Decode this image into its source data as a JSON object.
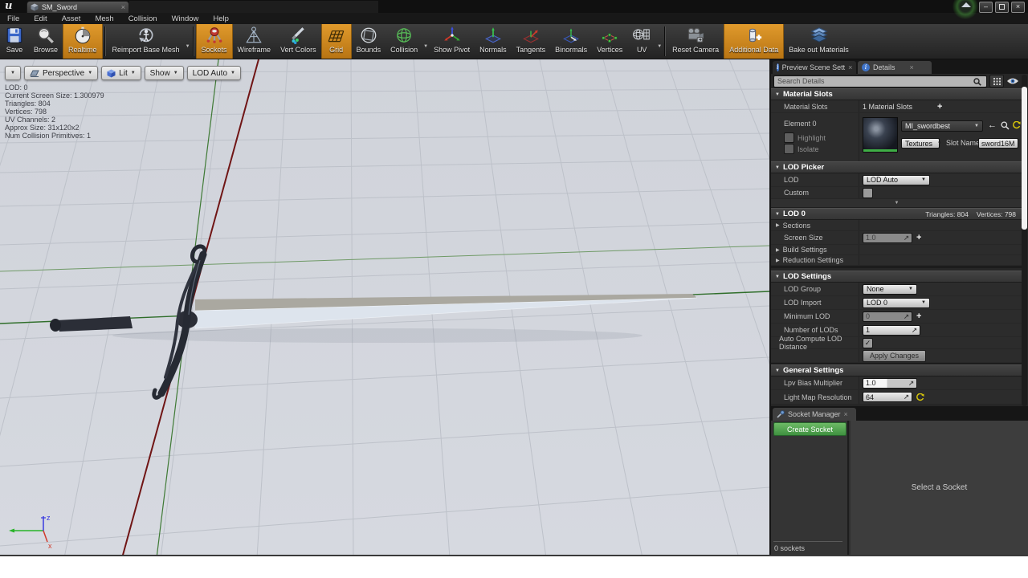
{
  "window": {
    "tab_title": "SM_Sword",
    "menu_items": [
      "File",
      "Edit",
      "Asset",
      "Mesh",
      "Collision",
      "Window",
      "Help"
    ],
    "minimize": "–",
    "close": "×"
  },
  "toolbar": {
    "items": [
      {
        "label": "Save"
      },
      {
        "label": "Browse"
      },
      {
        "label": "Realtime",
        "active": true
      },
      {
        "label": "Reimport Base Mesh",
        "dropdown": true
      },
      {
        "label": "Sockets",
        "active": true
      },
      {
        "label": "Wireframe"
      },
      {
        "label": "Vert Colors"
      },
      {
        "label": "Grid",
        "active": true
      },
      {
        "label": "Bounds"
      },
      {
        "label": "Collision",
        "dropdown": true
      },
      {
        "label": "Show Pivot"
      },
      {
        "label": "Normals"
      },
      {
        "label": "Tangents"
      },
      {
        "label": "Binormals"
      },
      {
        "label": "Vertices"
      },
      {
        "label": "UV",
        "dropdown": true
      },
      {
        "label": "Reset Camera"
      },
      {
        "label": "Additional Data",
        "active": true
      },
      {
        "label": "Bake out Materials"
      }
    ]
  },
  "viewport": {
    "buttons": {
      "perspective": "Perspective",
      "lit": "Lit",
      "show": "Show",
      "lod": "LOD Auto"
    },
    "stats": [
      "LOD:  0",
      "Current Screen Size:  1.300979",
      "Triangles:  804",
      "Vertices:  798",
      "UV Channels:  2",
      "Approx Size:  31x120x2",
      "Num Collision Primitives:  1"
    ],
    "gizmo": {
      "z_label": "z",
      "x_label": "x"
    }
  },
  "details": {
    "tab_preview": "Preview Scene Sett",
    "tab_details": "Details",
    "search_placeholder": "Search Details",
    "material_slots": {
      "header": "Material Slots",
      "slots_label": "Material Slots",
      "slots_value": "1 Material Slots",
      "element_label": "Element 0",
      "highlight_label": "Highlight",
      "isolate_label": "Isolate",
      "material_name": "MI_swordbest",
      "textures_label": "Textures",
      "slot_name_label": "Slot Name",
      "slot_name_value": "sword16M"
    },
    "lod_picker": {
      "header": "LOD Picker",
      "lod_label": "LOD",
      "lod_value": "LOD Auto",
      "custom_label": "Custom"
    },
    "lod0": {
      "header": "LOD 0",
      "triangles": "Triangles: 804",
      "vertices": "Vertices: 798",
      "sections_label": "Sections",
      "screen_size_label": "Screen Size",
      "screen_size_value": "1.0",
      "build_settings_label": "Build Settings",
      "reduction_settings_label": "Reduction Settings"
    },
    "lod_settings": {
      "header": "LOD Settings",
      "lod_group_label": "LOD Group",
      "lod_group_value": "None",
      "lod_import_label": "LOD Import",
      "lod_import_value": "LOD 0",
      "minimum_lod_label": "Minimum LOD",
      "minimum_lod_value": "0",
      "number_of_lods_label": "Number of LODs",
      "number_of_lods_value": "1",
      "auto_compute_label": "Auto Compute LOD Distance",
      "apply_label": "Apply Changes"
    },
    "general": {
      "header": "General Settings",
      "lpv_label": "Lpv Bias Multiplier",
      "lpv_value": "1.0",
      "lightmap_label": "Light Map Resolution",
      "lightmap_value": "64"
    }
  },
  "sockets": {
    "tab": "Socket Manager",
    "create_button": "Create Socket",
    "count": "0 sockets",
    "empty_text": "Select a Socket"
  },
  "colors": {
    "toolbar_active": "#cf8a1d",
    "create_green": "#4f9f4f",
    "axis_red": "#701515",
    "axis_green": "#2f6e2a"
  }
}
